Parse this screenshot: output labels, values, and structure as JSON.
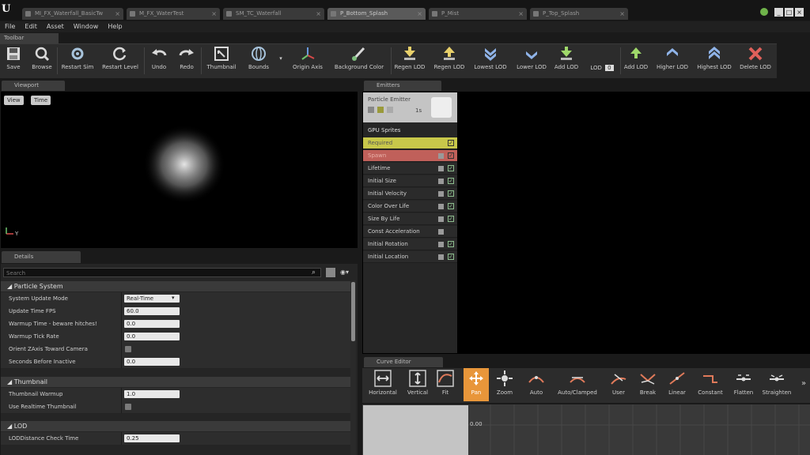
{
  "titlebar": {
    "tabs": [
      "MI_FX_Waterfall_BasicTw",
      "M_FX_WaterTest",
      "SM_TC_Waterfall",
      "P_Bottom_Splash",
      "P_Mist",
      "P_Top_Splash"
    ],
    "active_tab_index": 3,
    "controls": [
      "_",
      "□",
      "×"
    ]
  },
  "menu": [
    "File",
    "Edit",
    "Asset",
    "Window",
    "Help"
  ],
  "toolbar": {
    "tab_label": "Toolbar",
    "buttons": [
      "Save",
      "Browse",
      "Restart Sim",
      "Restart Level",
      "Undo",
      "Redo",
      "Thumbnail",
      "Bounds",
      "Origin Axis",
      "Background Color",
      "Regen LOD",
      "Regen LOD",
      "Lowest LOD",
      "Lower LOD",
      "Add LOD",
      "Add LOD",
      "Higher LOD",
      "Highest LOD",
      "Delete LOD"
    ],
    "lod_label": "LOD",
    "lod_value": "0"
  },
  "viewport": {
    "tab_label": "Viewport",
    "view_button": "View",
    "time_button": "Time"
  },
  "details": {
    "tab_label": "Details",
    "search_placeholder": "Search",
    "sections": [
      {
        "title": "Particle System",
        "props": [
          {
            "label": "System Update Mode",
            "value": "Real-Time",
            "type": "dropdown"
          },
          {
            "label": "Update Time FPS",
            "value": "60.0",
            "type": "number"
          },
          {
            "label": "Warmup Time - beware hitches!",
            "value": "0.0",
            "type": "number"
          },
          {
            "label": "Warmup Tick Rate",
            "value": "0.0",
            "type": "number"
          },
          {
            "label": "Orient ZAxis Toward Camera",
            "value": "",
            "type": "checkbox"
          },
          {
            "label": "Seconds Before Inactive",
            "value": "0.0",
            "type": "number"
          }
        ]
      },
      {
        "title": "Thumbnail",
        "props": [
          {
            "label": "Thumbnail Warmup",
            "value": "1.0",
            "type": "number"
          },
          {
            "label": "Use Realtime Thumbnail",
            "value": "",
            "type": "checkbox"
          }
        ]
      },
      {
        "title": "LOD",
        "props": [
          {
            "label": "LODDistance Check Time",
            "value": "0.25",
            "type": "number"
          }
        ]
      }
    ]
  },
  "emitters": {
    "tab_label": "Emitters",
    "emitter_name": "Particle Emitter",
    "emitter_count": "1s",
    "type_label": "GPU Sprites",
    "modules": [
      {
        "label": "Required",
        "color": "#c8c84a"
      },
      {
        "label": "Spawn",
        "color": "#c0605a"
      },
      {
        "label": "Lifetime",
        "color": ""
      },
      {
        "label": "Initial Size",
        "color": ""
      },
      {
        "label": "Initial Velocity",
        "color": ""
      },
      {
        "label": "Color Over Life",
        "color": ""
      },
      {
        "label": "Size By Life",
        "color": ""
      },
      {
        "label": "Const Acceleration",
        "color": ""
      },
      {
        "label": "Initial Rotation",
        "color": ""
      },
      {
        "label": "Initial Location",
        "color": ""
      }
    ]
  },
  "curve_editor": {
    "tab_label": "Curve Editor",
    "buttons": [
      "Horizontal",
      "Vertical",
      "Fit",
      "Pan",
      "Zoom",
      "Auto",
      "Auto/Clamped",
      "User",
      "Break",
      "Linear",
      "Constant",
      "Flatten",
      "Straighten"
    ],
    "active_button": "Pan",
    "axis_value": "0.00"
  }
}
